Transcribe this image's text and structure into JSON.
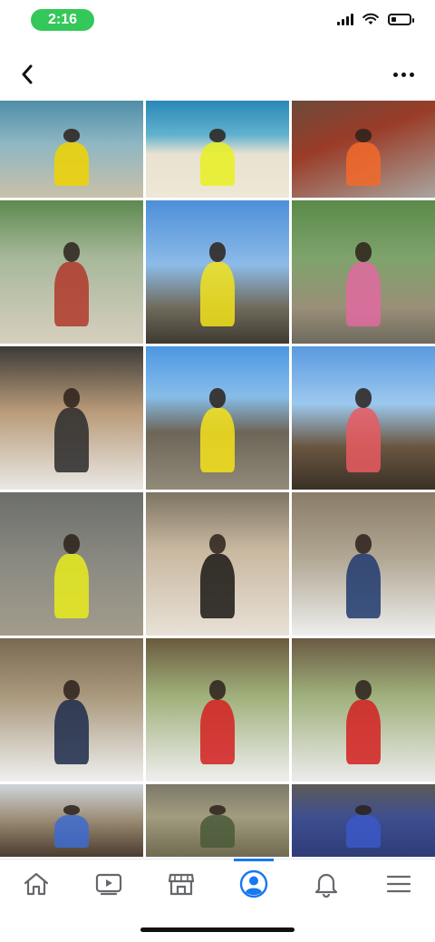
{
  "status": {
    "time": "2:16",
    "battery_level": 0.3
  },
  "topbar": {
    "back_icon": "chevron-left-icon",
    "more_icon": "more-horizontal-icon"
  },
  "photos": [
    {
      "bg": "linear-gradient(180deg,#4f8ea8 0%,#8fb7c3 45%,#c9c0a8 100%)",
      "accent": "#f0d400"
    },
    {
      "bg": "linear-gradient(180deg,#2a88b6 0%,#5fb1cf 35%,#e9e2d0 55%,#efe7d6 100%)",
      "accent": "#e8f020"
    },
    {
      "bg": "linear-gradient(160deg,#6e4a3a 0%,#9a3c28 40%,#a8a59f 100%)",
      "accent": "#f26a2a"
    },
    {
      "bg": "linear-gradient(180deg,#5d8a4f 0%,#a7b89a 40%,#d7cfbf 100%)",
      "accent": "#b0382c"
    },
    {
      "bg": "linear-gradient(180deg,#4d8fd8 0%,#8cbbe8 45%,#6f6a5b 75%,#3f3a30 100%)",
      "accent": "#f2e21c"
    },
    {
      "bg": "linear-gradient(180deg,#5a8a4a 0%,#7ea36c 40%,#9a8f78 75%,#6e6a5e 100%)",
      "accent": "#e06aa0"
    },
    {
      "bg": "linear-gradient(180deg,#3b3a38 0%,#b89a78 45%,#eae8e4 100%)",
      "accent": "#2a2a2a"
    },
    {
      "bg": "linear-gradient(180deg,#4c97e3 0%,#87bde9 35%,#6d6658 60%,#918a79 100%)",
      "accent": "#f6e21a"
    },
    {
      "bg": "linear-gradient(180deg,#5a9ae0 0%,#9cc8ee 40%,#6a5640 70%,#3a3026 100%)",
      "accent": "#e85a60"
    },
    {
      "bg": "linear-gradient(180deg,#6c6e6a 0%,#8b8a82 50%,#a39c8c 100%)",
      "accent": "#e8ec1c"
    },
    {
      "bg": "linear-gradient(180deg,#7d7463 0%,#c9b8a0 40%,#e7e1d6 100%)",
      "accent": "#1a1714"
    },
    {
      "bg": "linear-gradient(180deg,#8b7d68 0%,#b0a692 45%,#eeeeee 100%)",
      "accent": "#1e3a6e"
    },
    {
      "bg": "linear-gradient(180deg,#7a6a52 0%,#a9987c 40%,#f0f0f0 100%)",
      "accent": "#1c2a4a"
    },
    {
      "bg": "linear-gradient(180deg,#6b5a3f 0%,#9fb07a 40%,#efefef 100%)",
      "accent": "#d42020"
    },
    {
      "bg": "linear-gradient(180deg,#6a5a42 0%,#9fb07c 40%,#ececec 100%)",
      "accent": "#d42020"
    },
    {
      "bg": "linear-gradient(180deg,#cfd5dc 0%,#9a8a72 50%,#4a3c30 100%)",
      "accent": "#3d6bd0"
    },
    {
      "bg": "linear-gradient(180deg,#7c7868 0%,#a29c80 45%,#6f6a50 100%)",
      "accent": "#4a5a3a"
    },
    {
      "bg": "linear-gradient(180deg,#5c5a56 0%,#3f4f8f 45%,#2e3c78 100%)",
      "accent": "#3b58c8"
    }
  ],
  "tabbar": {
    "tabs": [
      {
        "icon": "home-icon"
      },
      {
        "icon": "video-icon"
      },
      {
        "icon": "marketplace-icon"
      },
      {
        "icon": "profile-icon",
        "active": true
      },
      {
        "icon": "notifications-bell-icon"
      },
      {
        "icon": "menu-icon"
      }
    ],
    "active_color": "#1877f2",
    "inactive_color": "#65676b"
  }
}
